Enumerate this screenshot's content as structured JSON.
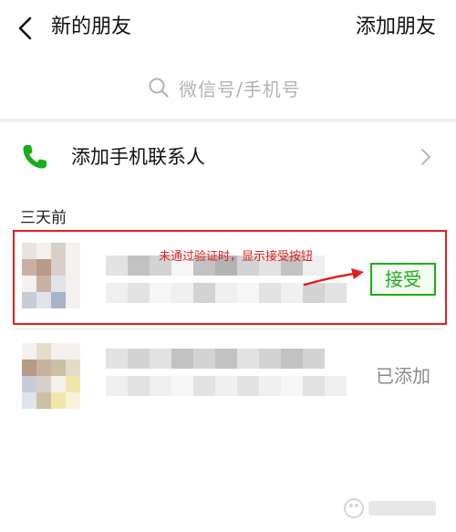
{
  "header": {
    "title": "新的朋友",
    "action_label": "添加朋友"
  },
  "search": {
    "placeholder": "微信号/手机号"
  },
  "add_contacts": {
    "label": "添加手机联系人"
  },
  "section": {
    "label": "三天前"
  },
  "requests": [
    {
      "action_label": "接受",
      "action_type": "accept"
    },
    {
      "action_label": "已添加",
      "action_type": "added"
    }
  ],
  "annotation": {
    "text": "未通过验证时，显示接受按钮"
  },
  "colors": {
    "accent": "#1aad19",
    "annotation": "#e02020",
    "muted": "#8a8a8a",
    "placeholder": "#b2b2b2"
  },
  "icons": {
    "back": "chevron-left-icon",
    "search": "search-icon",
    "phone": "phone-icon",
    "chevron": "chevron-right-icon"
  }
}
